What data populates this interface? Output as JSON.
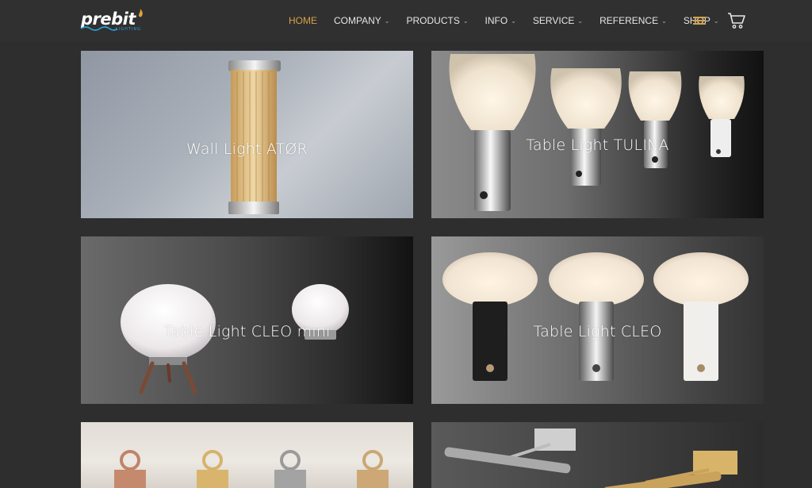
{
  "brand": {
    "name": "prebit",
    "tagline": "LIGHTING"
  },
  "nav": {
    "home": "HOME",
    "items": [
      {
        "label": "COMPANY",
        "chevron": "⌄"
      },
      {
        "label": "PRODUCTS",
        "chevron": "⌄"
      },
      {
        "label": "INFO",
        "chevron": "⌄"
      },
      {
        "label": "SERVICE",
        "chevron": "⌄"
      },
      {
        "label": "REFERENCE",
        "chevron": "⌄"
      },
      {
        "label": "SHOP",
        "chevron": "⌄"
      }
    ]
  },
  "icons": {
    "menu": "hamburger-icon",
    "cart": "cart-icon"
  },
  "colors": {
    "accent": "#d8a24a",
    "header_bg": "#303030",
    "page_bg": "#2e2e2e"
  },
  "products": [
    {
      "label": "Wall Light ATØR"
    },
    {
      "label": "Table Light TULINA"
    },
    {
      "label": "Table Light CLEO mini"
    },
    {
      "label": "Table Light CLEO"
    },
    {
      "label": ""
    },
    {
      "label": ""
    }
  ]
}
